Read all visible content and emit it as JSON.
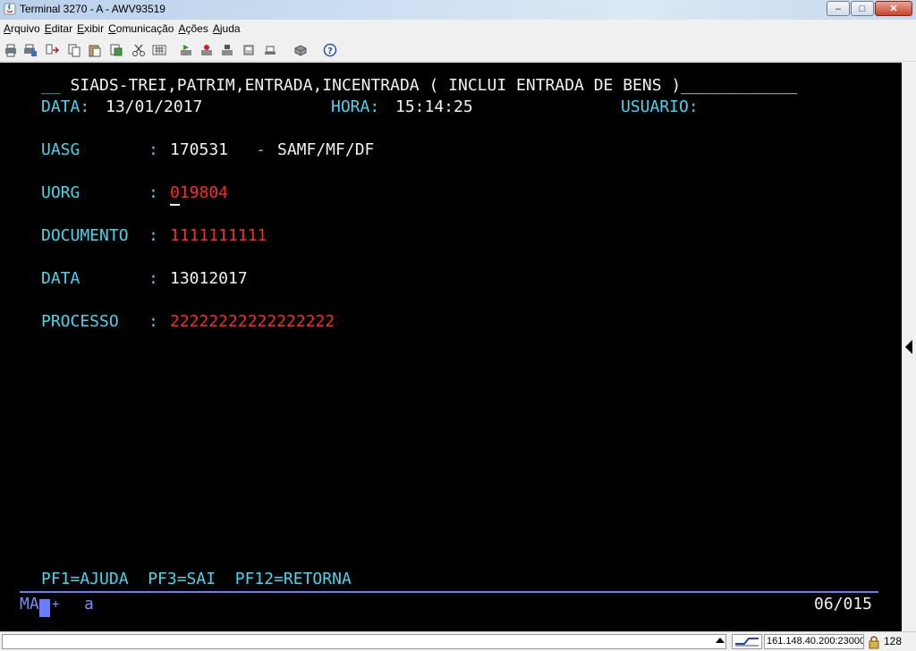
{
  "window": {
    "title": "Terminal 3270 - A - AWV93519",
    "buttons": {
      "minimize": "–",
      "maximize": "□",
      "close": "✕"
    }
  },
  "menu": {
    "items": [
      {
        "first": "A",
        "rest": "rquivo"
      },
      {
        "first": "E",
        "rest": "ditar"
      },
      {
        "first": "E",
        "rest": "xibir"
      },
      {
        "first": "C",
        "rest": "omunicação"
      },
      {
        "first": "A",
        "rest": "ções"
      },
      {
        "first": "A",
        "rest": "juda"
      }
    ]
  },
  "toolbar": {
    "icons": [
      "print-screen-icon",
      "print-setup-icon",
      "transfer-icon",
      "copy-icon",
      "paste-icon",
      "copy-append-icon",
      "cut-icon",
      "keypad-icon",
      "macro-play-icon",
      "macro-record-icon",
      "macro-stop-icon",
      "send-file-icon",
      "receive-file-icon",
      "help-icon"
    ]
  },
  "screen": {
    "header_prefix": "__ ",
    "header": "SIADS-TREI,PATRIM,ENTRADA,INCENTRADA ( INCLUI ENTRADA DE BENS )",
    "header_suffix": "____________",
    "data_label": "DATA:",
    "data_value": "13/01/2017",
    "hora_label": "HORA:",
    "hora_value": "15:14:25",
    "usuario_label": "USUARIO:",
    "fields": {
      "uasg_label": "UASG",
      "uasg_value": "170531",
      "uasg_dash": "-",
      "uasg_desc": "SAMF/MF/DF",
      "uorg_label": "UORG",
      "uorg_value": "019804",
      "documento_label": "DOCUMENTO",
      "documento_value": "1111111111",
      "data2_label": "DATA",
      "data2_value": "13012017",
      "processo_label": "PROCESSO",
      "processo_value": "22222222222222222",
      "colon": ":"
    },
    "pf_keys": "PF1=AJUDA  PF3=SAI  PF12=RETORNA",
    "oia": {
      "mode": "MA",
      "plus": "+",
      "session": "a",
      "cursor_pos": "06/015"
    }
  },
  "statusbar": {
    "host": "161.148.40.200:23000",
    "lock_icon": "lock-icon",
    "encryption": "128"
  },
  "colors": {
    "terminal_bg": "#000000",
    "field_label": "#44d7f0",
    "protected_value": "#f2f2f2",
    "input_value": "#ff2a1f",
    "oia": "#6a7dff"
  }
}
